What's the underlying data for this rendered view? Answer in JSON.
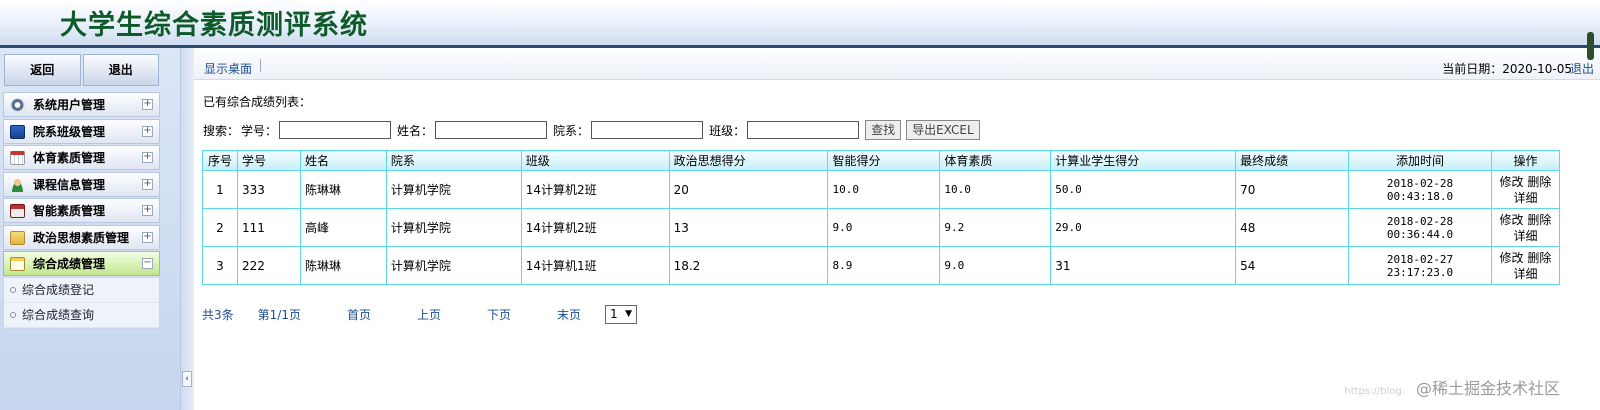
{
  "app": {
    "title": "大学生综合素质测评系统"
  },
  "sidebar": {
    "top_buttons": [
      {
        "label": "返回"
      },
      {
        "label": "退出"
      }
    ],
    "menu": [
      {
        "label": "系统用户管理",
        "icon": "gear-icon",
        "toggle": "+"
      },
      {
        "label": "院系班级管理",
        "icon": "monitor-icon",
        "toggle": "+"
      },
      {
        "label": "体育素质管理",
        "icon": "calendar-icon",
        "toggle": "+"
      },
      {
        "label": "课程信息管理",
        "icon": "user-icon",
        "toggle": "+"
      },
      {
        "label": "智能素质管理",
        "icon": "calculator-icon",
        "toggle": "+"
      },
      {
        "label": "政治思想素质管理",
        "icon": "folder-icon",
        "toggle": "+"
      },
      {
        "label": "综合成绩管理",
        "icon": "notepad-icon",
        "toggle": "−"
      }
    ],
    "submenu": [
      {
        "label": "综合成绩登记"
      },
      {
        "label": "综合成绩查询"
      }
    ],
    "collapse_symbol": "‹"
  },
  "topbar": {
    "desktop_link": "显示桌面",
    "date_text": "当前日期：2020-10-05",
    "logout": "退出"
  },
  "content": {
    "list_title": "已有综合成绩列表：",
    "search": {
      "prefix": "搜索：",
      "student_no_label": "学号：",
      "name_label": "姓名：",
      "department_label": "院系：",
      "class_label": "班级：",
      "search_button": "查找",
      "export_button": "导出EXCEL"
    },
    "table": {
      "headers": [
        "序号",
        "学号",
        "姓名",
        "院系",
        "班级",
        "政治思想得分",
        "智能得分",
        "体育素质",
        "计算业学生得分",
        "最终成绩",
        "添加时间",
        "操作"
      ],
      "rows": [
        {
          "index": "1",
          "student_no": "333",
          "name": "陈琳琳",
          "department": "计算机学院",
          "class": "14计算机2班",
          "political": "20",
          "intelligence": "10.0",
          "sports": "10.0",
          "business": "50.0",
          "final": "70",
          "added": "2018-02-28 00:43:18.0",
          "edit": "修改",
          "delete": "删除",
          "detail": "详细"
        },
        {
          "index": "2",
          "student_no": "111",
          "name": "高峰",
          "department": "计算机学院",
          "class": "14计算机2班",
          "political": "13",
          "intelligence": "9.0",
          "sports": "9.2",
          "business": "29.0",
          "final": "48",
          "added": "2018-02-28 00:36:44.0",
          "edit": "修改",
          "delete": "删除",
          "detail": "详细"
        },
        {
          "index": "3",
          "student_no": "222",
          "name": "陈琳琳",
          "department": "计算机学院",
          "class": "14计算机1班",
          "political": "18.2",
          "intelligence": "8.9",
          "sports": "9.0",
          "business": "31",
          "final": "54",
          "added": "2018-02-27 23:17:23.0",
          "edit": "修改",
          "delete": "删除",
          "detail": "详细"
        }
      ]
    },
    "pager": {
      "total": "共3条",
      "page_info": "第1/1页",
      "first": "首页",
      "prev": "上页",
      "next": "下页",
      "last": "末页",
      "page_select": "1"
    }
  },
  "watermark": {
    "small": "https://blog.",
    "main": "@稀土掘金技术社区"
  }
}
